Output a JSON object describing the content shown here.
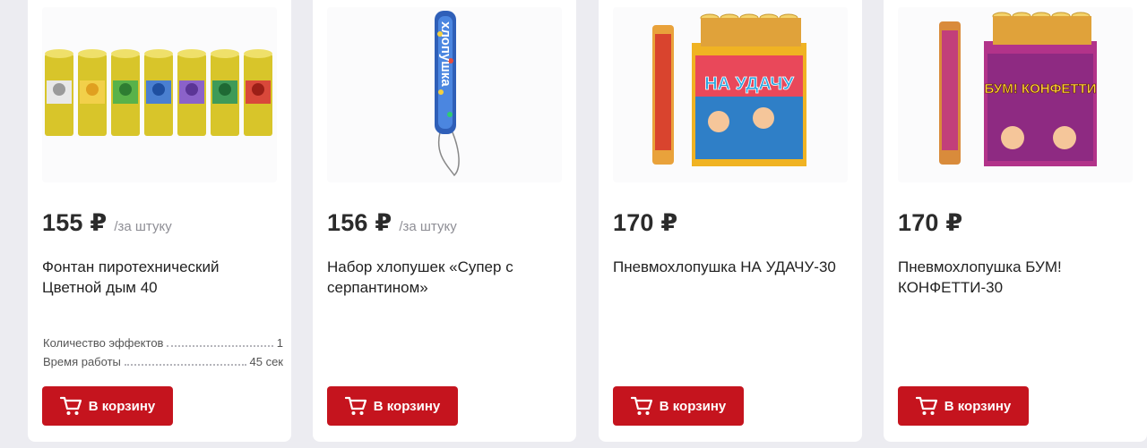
{
  "products": [
    {
      "price": "155 ₽",
      "unit": "/за штуку",
      "title": "Фонтан пиротехнический Цветной дым 40",
      "specs": [
        {
          "label": "Количество эффектов",
          "value": "1"
        },
        {
          "label": "Время работы",
          "value": "45 сек"
        }
      ],
      "button": "В корзину",
      "image": "smoke-fountain-tubes-image"
    },
    {
      "price": "156 ₽",
      "unit": "/за штуку",
      "title": "Набор хлопушек «Супер с серпантином»",
      "button": "В корзину",
      "image": "party-popper-image",
      "image_text": "хлопушка"
    },
    {
      "price": "170 ₽",
      "title": "Пневмохлопушка НА УДАЧУ-30",
      "button": "В корзину",
      "image": "confetti-cannon-box-image",
      "image_text": "НА УДАЧУ"
    },
    {
      "price": "170 ₽",
      "title": "Пневмохлопушка БУМ! КОНФЕТТИ-30",
      "button": "В корзину",
      "image": "confetti-cannon-box-image",
      "image_text": "БУМ! КОНФЕТТИ"
    }
  ],
  "colors": {
    "accent": "#c5141e",
    "background": "#ececf1",
    "card": "#ffffff"
  }
}
